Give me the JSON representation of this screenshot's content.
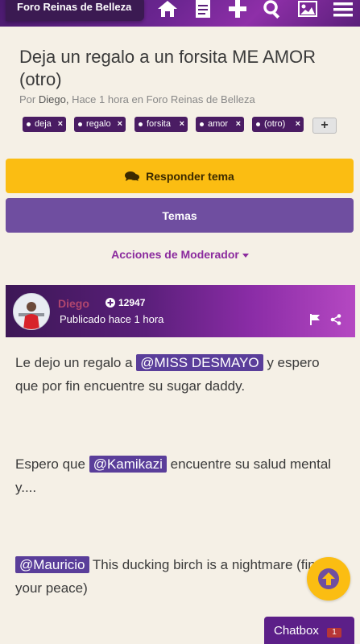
{
  "header": {
    "breadcrumb": "Foro Reinas de Belleza",
    "icons": [
      "home-icon",
      "document-icon",
      "plus-icon",
      "search-icon",
      "image-icon",
      "menu-icon"
    ]
  },
  "topic": {
    "title": "Deja un regalo a un forsita ME AMOR (otro)",
    "by_prefix": "Por",
    "author": "Diego,",
    "time_forum": "Hace 1 hora en Foro Reinas de Belleza"
  },
  "tags": [
    {
      "label": "deja"
    },
    {
      "label": "regalo"
    },
    {
      "label": "forsita"
    },
    {
      "label": "amor"
    },
    {
      "label": "(otro)"
    }
  ],
  "tag_remove_symbol": "×",
  "tag_add_symbol": "+",
  "actions": {
    "reply_label": "Responder tema",
    "topics_label": "Temas",
    "moderator_label": "Acciones de Moderador"
  },
  "post": {
    "author": "Diego",
    "points": "12947",
    "published": "Publicado hace 1 hora",
    "paragraphs": [
      {
        "pre": "Le dejo un regalo a ",
        "mention": "@MISS DESMAYO",
        "post": " y espero  que por fin encuentre su sugar daddy."
      },
      {
        "pre": "Espero que ",
        "mention": "@Kamikazi",
        "post": " encuentre su salud mental y...."
      },
      {
        "pre": "",
        "mention": "@Mauricio",
        "post": " This ducking birch is a  nightmare (find your peace)"
      }
    ]
  },
  "chatbox": {
    "label": "Chatbox",
    "count": "1"
  },
  "colors": {
    "brand_purple": "#5c1f88",
    "accent_yellow": "#fbbd12",
    "button_purple": "#6f4ea0",
    "mention_bg": "#5a3e9a",
    "page_bg": "#f5f0e6"
  }
}
